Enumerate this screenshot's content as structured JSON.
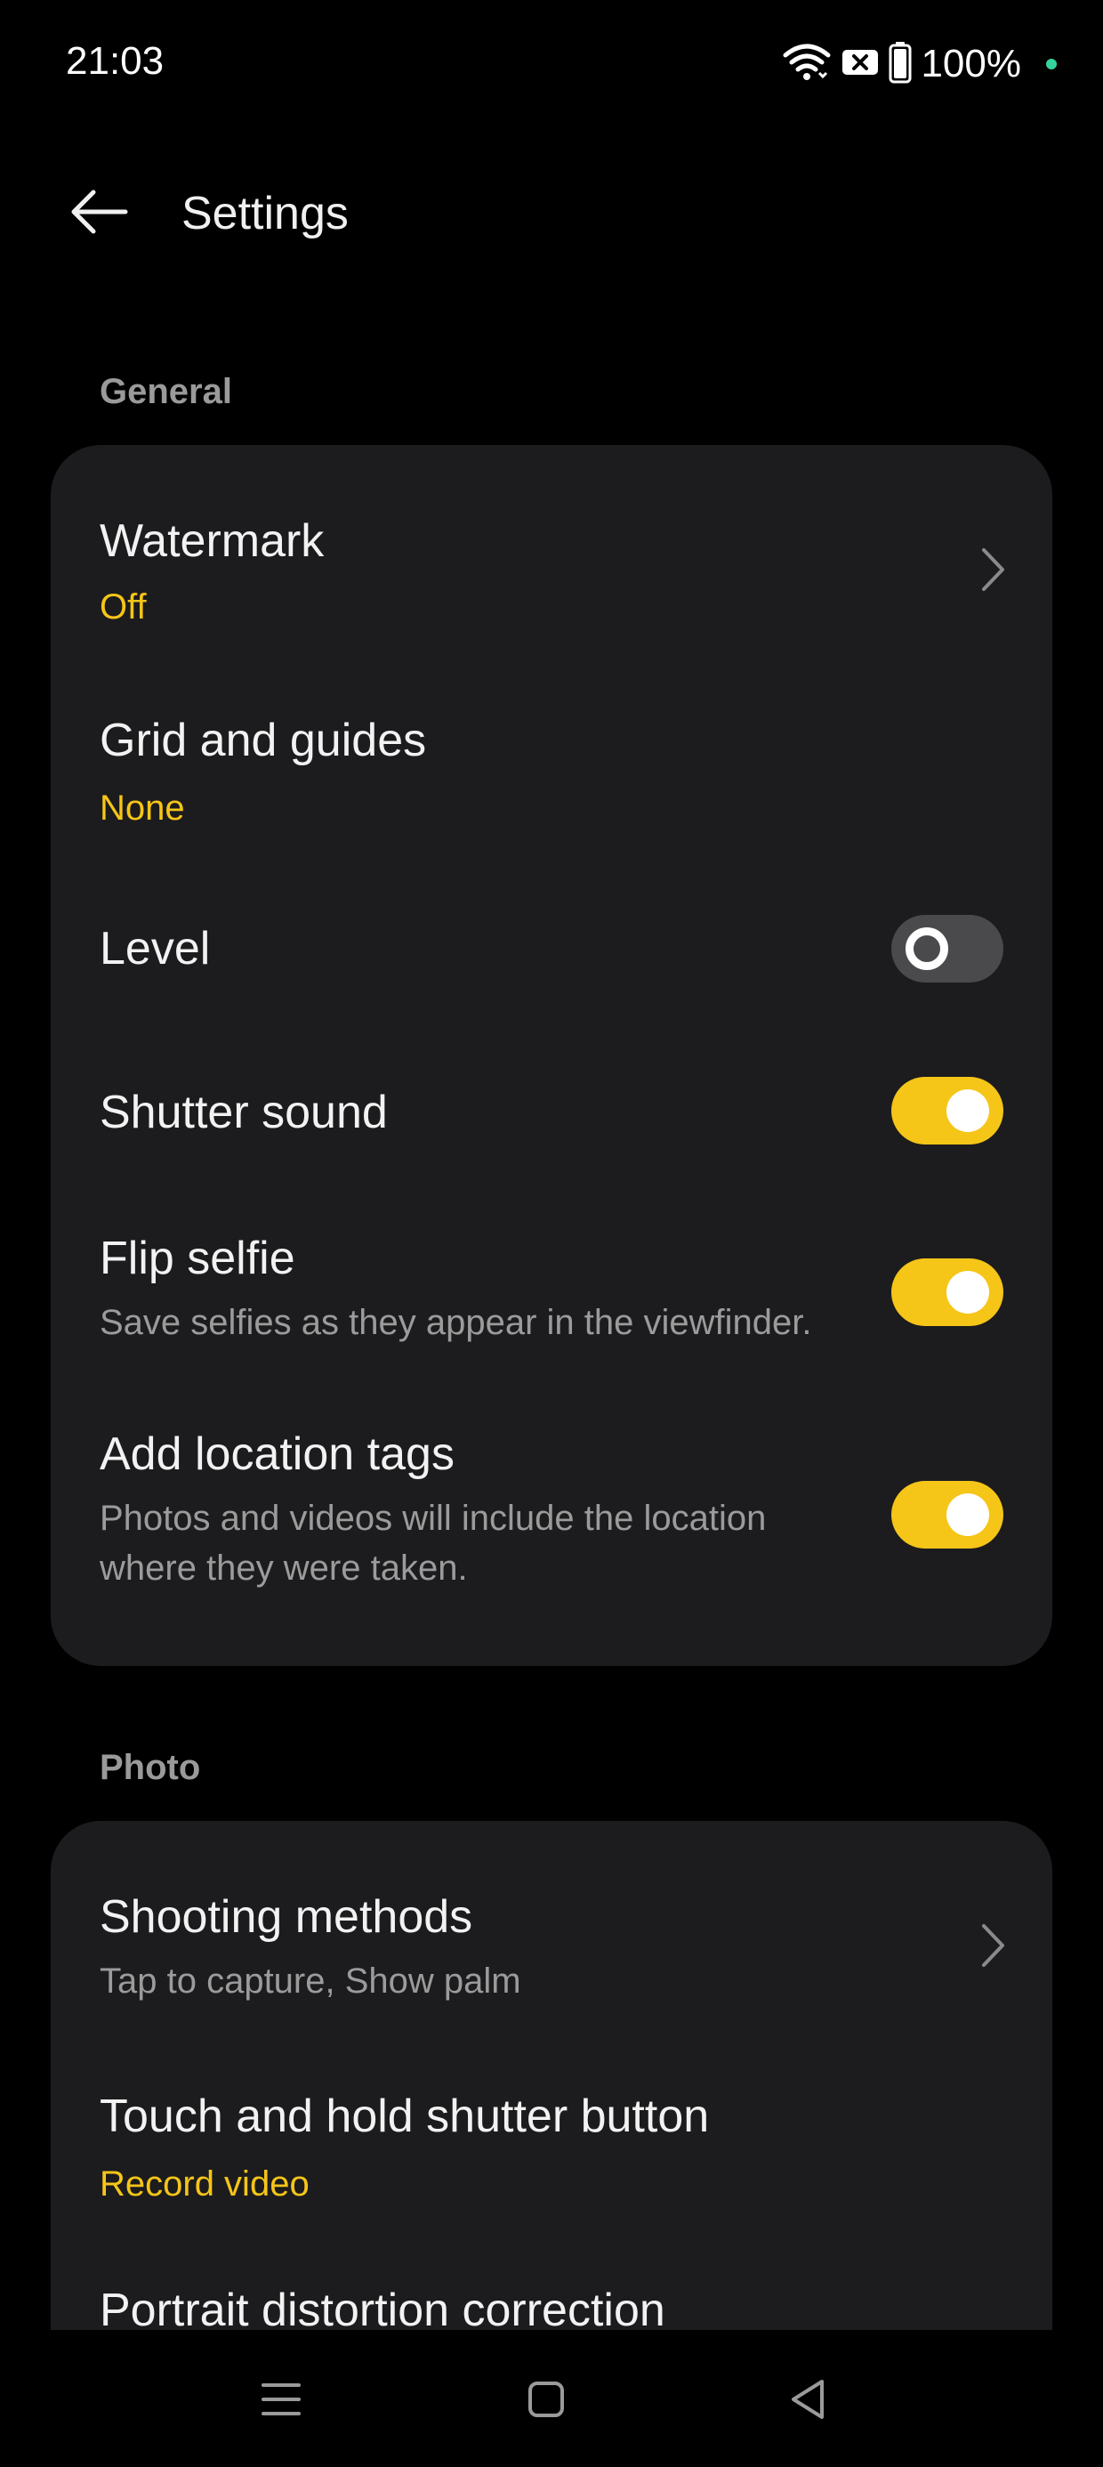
{
  "status_bar": {
    "time": "21:03",
    "battery_text": "100%",
    "icons": [
      "wifi-icon",
      "sim-blocked-icon",
      "battery-icon",
      "status-dot"
    ]
  },
  "app_bar": {
    "title": "Settings",
    "back_icon": "arrow-left-icon"
  },
  "sections": {
    "general": {
      "label": "General",
      "items": [
        {
          "title": "Watermark",
          "value": "Off",
          "control": "chevron"
        },
        {
          "title": "Grid and guides",
          "value": "None"
        },
        {
          "title": "Level",
          "control": "toggle",
          "state": "off"
        },
        {
          "title": "Shutter sound",
          "control": "toggle",
          "state": "on"
        },
        {
          "title": "Flip selfie",
          "description": "Save selfies as they appear in the viewfinder.",
          "control": "toggle",
          "state": "on"
        },
        {
          "title": "Add location tags",
          "description_line1": "Photos and videos will include the location",
          "description_line2": "where they were taken.",
          "control": "toggle",
          "state": "on"
        }
      ]
    },
    "photo": {
      "label": "Photo",
      "items": [
        {
          "title": "Shooting methods",
          "description": "Tap to capture, Show palm",
          "control": "chevron"
        },
        {
          "title": "Touch and hold shutter button",
          "value": "Record video"
        },
        {
          "title": "Portrait distortion correction"
        }
      ]
    }
  },
  "nav_bar": {
    "icons": [
      "menu-icon",
      "home-square-icon",
      "back-triangle-icon"
    ]
  },
  "colors": {
    "accent": "#f5c518",
    "card_bg": "#1c1c1e",
    "page_bg": "#000000",
    "toggle_off": "#4a4a4c"
  }
}
